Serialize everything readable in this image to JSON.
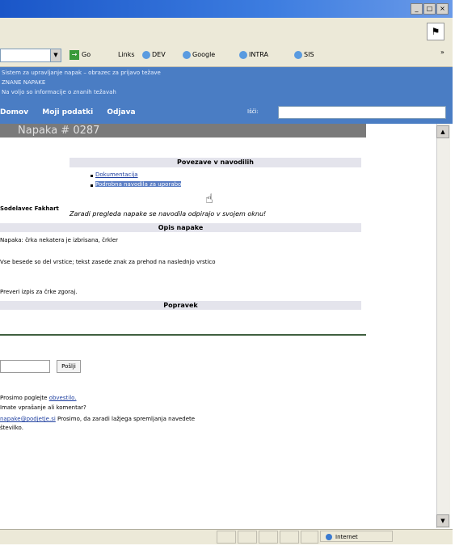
{
  "window": {
    "controls": [
      "_",
      "□",
      "×"
    ]
  },
  "toolbar": {
    "go_label": "Go",
    "links_label": "Links",
    "quicklinks": [
      "DEV",
      "Google",
      "INTRA",
      "SIS"
    ]
  },
  "header": {
    "line1": "Sistem za upravljanje napak – obrazec za prijavo težave",
    "line2": "ZNANE NAPAKE",
    "line3": "Na voljo so informacije o znanih težavah",
    "nav": [
      "Domov",
      "Moji podatki",
      "Odjava"
    ],
    "search_label": "Išči:"
  },
  "page": {
    "title": "Napaka # 0287"
  },
  "related": {
    "title": "Povezave v navodilih",
    "links": [
      "Dokumentacija",
      "Podrobna navodila za uporabo"
    ],
    "note": "Zaradi pregleda napake se navodila odpirajo v svojem oknu!"
  },
  "content": {
    "author": "Sodelavec Fakhart",
    "desc_title": "Opis napake",
    "desc_line1": "Napaka: črka nekatera je izbrisana, črkler",
    "desc_line2": "Vse besede so del vrstice; tekst zasede znak za prehod na naslednjo vrstico",
    "desc_line3": "Preveri izpis za črke zgoraj.",
    "answers_title": "Popravek",
    "send_label": "Pošlji"
  },
  "footer": {
    "line1_pre": "Prosimo poglejte",
    "line1_link": "obvestilo.",
    "line2": "Imate vprašanje ali komentar?",
    "line3_link": "napake@podjetje.si",
    "line3_post": "Prosimo, da zaradi lažjega spremljanja navedete",
    "line4": "številko."
  },
  "status": {
    "zone": "Internet"
  }
}
